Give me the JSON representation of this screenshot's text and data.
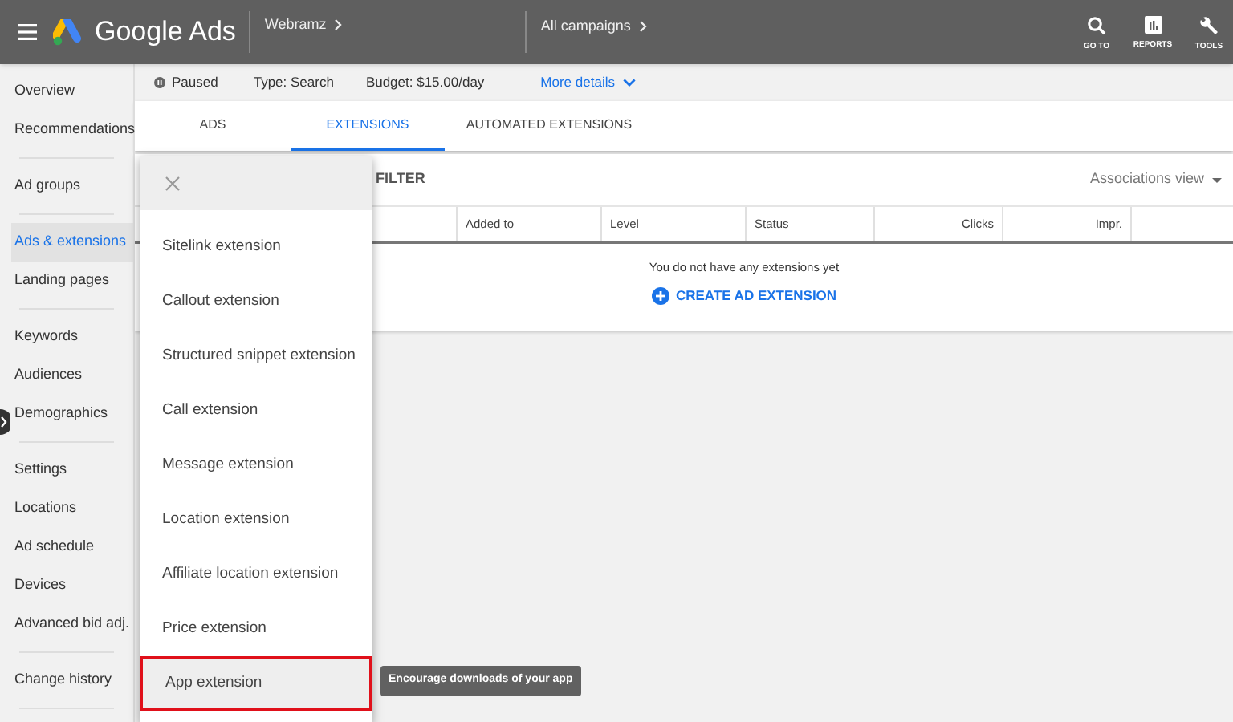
{
  "header": {
    "app_name": "Google Ads",
    "account": "Webramz",
    "campaigns": "All campaigns",
    "actions": [
      {
        "kind": "search",
        "label": "GO TO"
      },
      {
        "kind": "reports",
        "label": "REPORTS"
      },
      {
        "kind": "tools",
        "label": "TOOLS"
      }
    ]
  },
  "sidebar": {
    "groups": [
      {
        "items": [
          {
            "label": "Overview",
            "selected": false
          },
          {
            "label": "Recommendations",
            "selected": false
          }
        ]
      },
      {
        "items": [
          {
            "label": "Ad groups",
            "selected": false
          }
        ]
      },
      {
        "items": [
          {
            "label": "Ads & extensions",
            "selected": true
          },
          {
            "label": "Landing pages",
            "selected": false
          }
        ]
      },
      {
        "items": [
          {
            "label": "Keywords",
            "selected": false
          },
          {
            "label": "Audiences",
            "selected": false
          },
          {
            "label": "Demographics",
            "selected": false
          }
        ]
      },
      {
        "items": [
          {
            "label": "Settings",
            "selected": false
          },
          {
            "label": "Locations",
            "selected": false
          },
          {
            "label": "Ad schedule",
            "selected": false
          },
          {
            "label": "Devices",
            "selected": false
          },
          {
            "label": "Advanced bid adj.",
            "selected": false
          }
        ]
      },
      {
        "items": [
          {
            "label": "Change history",
            "selected": false
          }
        ]
      }
    ]
  },
  "campaign_bar": {
    "status": "Paused",
    "type": "Type: Search",
    "budget": "Budget: $15.00/day",
    "more_details": "More details"
  },
  "tabs": [
    {
      "label": "ADS",
      "selected": false
    },
    {
      "label": "EXTENSIONS",
      "selected": true
    },
    {
      "label": "AUTOMATED EXTENSIONS",
      "selected": false
    }
  ],
  "toolbar": {
    "filter": "FILTER",
    "view": "Associations view"
  },
  "table": {
    "columns": [
      "Added to",
      "Level",
      "Status",
      "Clicks",
      "Impr."
    ],
    "empty_message": "You do not have any extensions yet",
    "create_button": "CREATE AD EXTENSION"
  },
  "extension_menu": {
    "items": [
      {
        "label": "Sitelink extension",
        "selected": false
      },
      {
        "label": "Callout extension",
        "selected": false
      },
      {
        "label": "Structured snippet extension",
        "selected": false
      },
      {
        "label": "Call extension",
        "selected": false
      },
      {
        "label": "Message extension",
        "selected": false
      },
      {
        "label": "Location extension",
        "selected": false
      },
      {
        "label": "Affiliate location extension",
        "selected": false
      },
      {
        "label": "Price extension",
        "selected": false
      },
      {
        "label": "App extension",
        "selected": true,
        "tooltip": "Encourage downloads of your app"
      }
    ]
  }
}
